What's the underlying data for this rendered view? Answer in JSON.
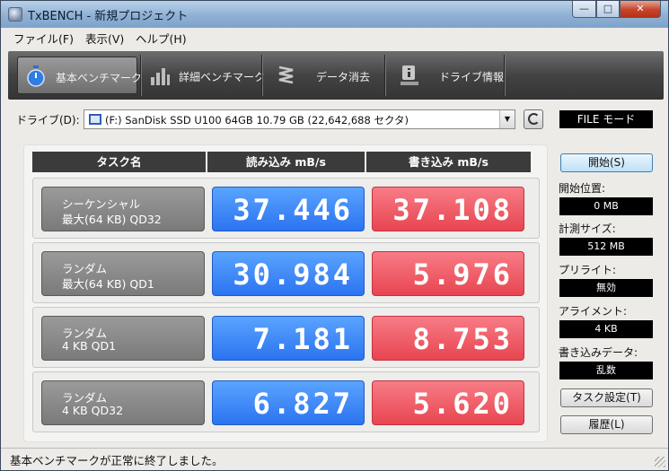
{
  "window": {
    "title": "TxBENCH - 新規プロジェクト",
    "min": "—",
    "max": "□",
    "close": "✕"
  },
  "menu": [
    "ファイル(F)",
    "表示(V)",
    "ヘルプ(H)"
  ],
  "toolbar": {
    "basic": "基本ベンチマーク",
    "detail": "詳細ベンチマーク",
    "erase": "データ消去",
    "info": "ドライブ情報"
  },
  "drive": {
    "label": "ドライブ(D):",
    "selected": "(F:) SanDisk SSD U100 64GB  10.79 GB (22,642,688 セクタ)",
    "mode": "FILE モード"
  },
  "table": {
    "headers": [
      "タスク名",
      "読み込み mB/s",
      "書き込み mB/s"
    ],
    "rows": [
      {
        "line1": "シーケンシャル",
        "line2": "最大(64 KB) QD32",
        "read": "37.446",
        "write": "37.108"
      },
      {
        "line1": "ランダム",
        "line2": "最大(64 KB) QD1",
        "read": "30.984",
        "write": "5.976"
      },
      {
        "line1": "ランダム",
        "line2": "4 KB QD1",
        "read": "7.181",
        "write": "8.753"
      },
      {
        "line1": "ランダム",
        "line2": "4 KB QD32",
        "read": "6.827",
        "write": "5.620"
      }
    ]
  },
  "side": {
    "start": "開始(S)",
    "start_pos_label": "開始位置:",
    "start_pos": "0 MB",
    "size_label": "計測サイズ:",
    "size": "512 MB",
    "preread_label": "プリライト:",
    "preread": "無効",
    "align_label": "アライメント:",
    "align": "4 KB",
    "wdata_label": "書き込みデータ:",
    "wdata": "乱数",
    "task_settings": "タスク設定(T)",
    "history": "履歴(L)"
  },
  "status": "基本ベンチマークが正常に終了しました。"
}
